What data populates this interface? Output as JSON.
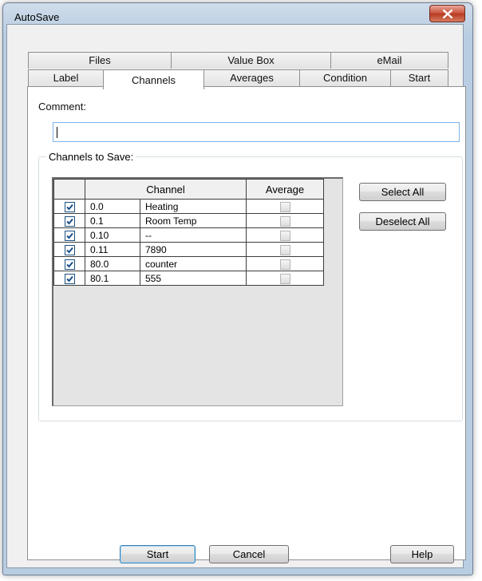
{
  "window": {
    "title": "AutoSave"
  },
  "tabs_back": [
    "Files",
    "Value Box",
    "eMail"
  ],
  "tabs_front": [
    "Label",
    "Channels",
    "Averages",
    "Condition",
    "Start"
  ],
  "active_tab": "Channels",
  "comment": {
    "label": "Comment:",
    "value": ""
  },
  "group": {
    "label": "Channels to Save:"
  },
  "grid": {
    "headers": [
      "Channel",
      "Average"
    ],
    "rows": [
      {
        "checked": true,
        "channel": "0.0",
        "name": "Heating",
        "average": false
      },
      {
        "checked": true,
        "channel": "0.1",
        "name": "Room Temp",
        "average": false
      },
      {
        "checked": true,
        "channel": "0.10",
        "name": "--",
        "average": false
      },
      {
        "checked": true,
        "channel": "0.11",
        "name": "7890",
        "average": false
      },
      {
        "checked": true,
        "channel": "80.0",
        "name": "counter",
        "average": false
      },
      {
        "checked": true,
        "channel": "80.1",
        "name": "555",
        "average": false
      }
    ]
  },
  "buttons": {
    "select_all": "Select All",
    "deselect_all": "Deselect All",
    "start": "Start",
    "cancel": "Cancel",
    "help": "Help"
  },
  "colors": {
    "check": "#1c4f8a",
    "close_button": "#c74d35"
  }
}
